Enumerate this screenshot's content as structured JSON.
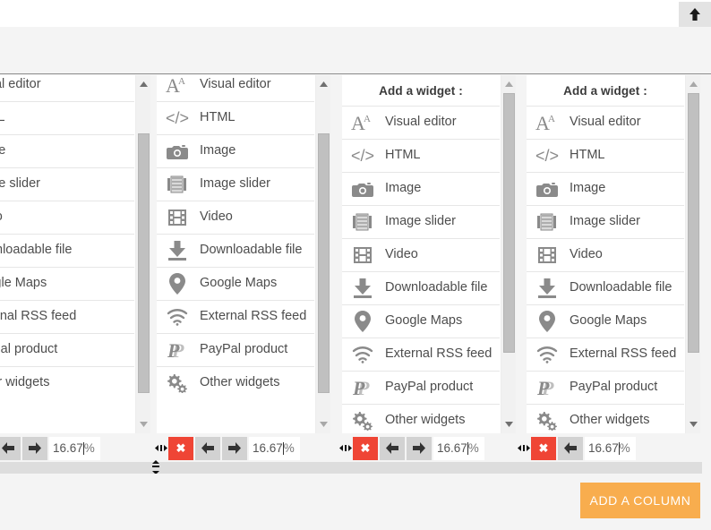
{
  "toolbar": {
    "scroll_top_icon": "arrow-up-icon",
    "scroll_top_label": ""
  },
  "widget_panel": {
    "title": "Add a widget :",
    "items": [
      {
        "label": "Visual editor",
        "icon": "visual-editor-icon"
      },
      {
        "label": "HTML",
        "icon": "code-icon"
      },
      {
        "label": "Image",
        "icon": "camera-icon"
      },
      {
        "label": "Image slider",
        "icon": "image-slider-icon"
      },
      {
        "label": "Video",
        "icon": "film-icon"
      },
      {
        "label": "Downloadable file",
        "icon": "download-icon"
      },
      {
        "label": "Google Maps",
        "icon": "map-pin-icon"
      },
      {
        "label": "External RSS feed",
        "icon": "rss-icon"
      },
      {
        "label": "PayPal product",
        "icon": "paypal-icon"
      },
      {
        "label": "Other widgets",
        "icon": "gears-icon"
      }
    ]
  },
  "columns": [
    {
      "name": "column-1",
      "width_value": "16.67",
      "width_unit": "%",
      "has_delete": false,
      "has_move_left": true,
      "has_move_right": true,
      "has_resize_handle": false,
      "move_left_icon": "arrow-left-icon",
      "move_right_icon": "arrow-right-icon",
      "delete_icon": "close-x-icon"
    },
    {
      "name": "column-2",
      "width_value": "16.67",
      "width_unit": "%",
      "has_delete": true,
      "has_move_left": true,
      "has_move_right": true,
      "has_resize_handle": true,
      "move_left_icon": "arrow-left-icon",
      "move_right_icon": "arrow-right-icon",
      "delete_icon": "close-x-icon"
    },
    {
      "name": "column-3",
      "width_value": "16.67",
      "width_unit": "%",
      "has_delete": true,
      "has_move_left": true,
      "has_move_right": true,
      "has_resize_handle": true,
      "move_left_icon": "arrow-left-icon",
      "move_right_icon": "arrow-right-icon",
      "delete_icon": "close-x-icon"
    },
    {
      "name": "column-4",
      "width_value": "16.67",
      "width_unit": "%",
      "has_delete": true,
      "has_move_left": true,
      "has_move_right": false,
      "has_resize_handle": true,
      "move_left_icon": "arrow-left-icon",
      "move_right_icon": "arrow-right-icon",
      "delete_icon": "close-x-icon"
    }
  ],
  "row_resize": {
    "grip_icon": "vertical-resize-icon"
  },
  "footer": {
    "add_column_label": "ADD A COLUMN"
  },
  "colors": {
    "accent_orange": "#f8ad4e",
    "delete_red": "#ef4535",
    "panel_bg": "#ffffff",
    "page_bg": "#f4f4f4",
    "button_gray": "#d2d2d2",
    "scrollbar_thumb": "#c0c0c0",
    "divider": "#e6e6e6",
    "text_primary": "#4d4d4d",
    "title_text": "#3b3b3b"
  }
}
